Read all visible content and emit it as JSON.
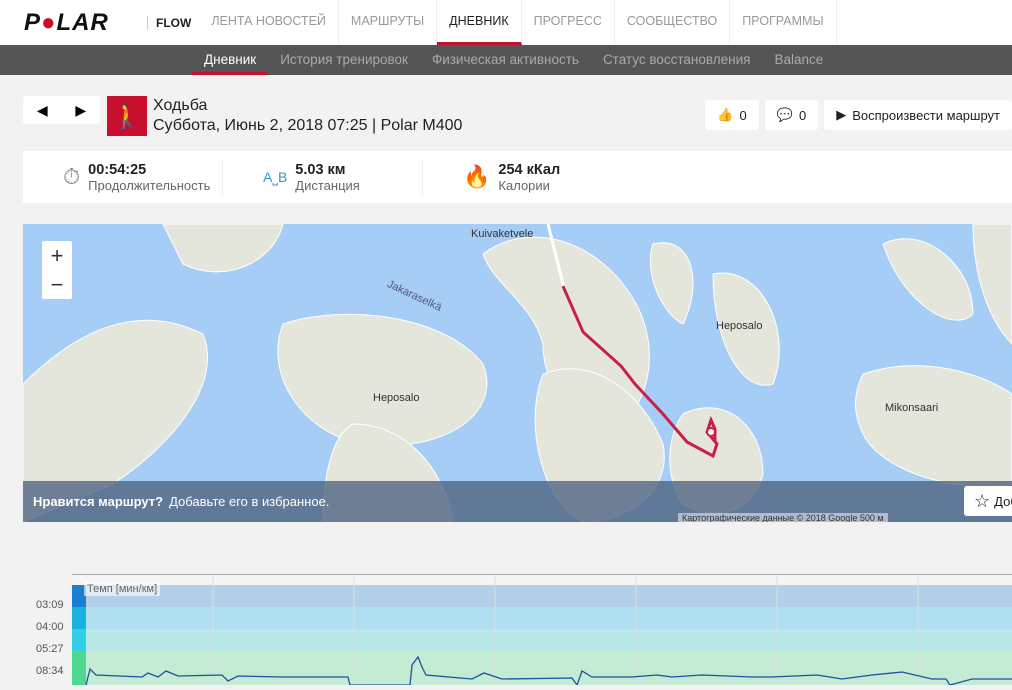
{
  "topnav": {
    "logo": "POLAR",
    "flow": "FLOW",
    "items": [
      "ЛЕНТА НОВОСТЕЙ",
      "МАРШРУТЫ",
      "ДНЕВНИК",
      "ПРОГРЕСС",
      "СООБЩЕСТВО",
      "ПРОГРАММЫ"
    ],
    "active": "ДНЕВНИК"
  },
  "subnav": {
    "items": [
      "Дневник",
      "История тренировок",
      "Физическая активность",
      "Статус восстановления",
      "Balance"
    ]
  },
  "session": {
    "sport": "Ходьба",
    "subtitle": "Суббота, Июнь 2, 2018 07:25 | Polar M400",
    "likes": "0",
    "comments": "0",
    "replay": "Воспроизвести маршрут"
  },
  "stats": [
    {
      "value": "00:54:25",
      "label": "Продолжительность",
      "icon": "stopwatch-icon"
    },
    {
      "value": "5.03 км",
      "label": "Дистанция",
      "icon": "distance-icon"
    },
    {
      "value": "254 кКал",
      "label": "Калории",
      "icon": "flame-icon"
    }
  ],
  "map": {
    "zoom_in": "+",
    "zoom_out": "−",
    "labels": [
      "Kuivaketvele",
      "Jakarasel­kä",
      "Heposalo",
      "Heposalo",
      "Mikonsaari"
    ],
    "like_bold": "Нравится маршрут?",
    "like_text": "Добавьте его в избранное.",
    "fav": "Добавить",
    "attribution": "Картографические данные © 2018 Google   500 м",
    "google": "Google",
    "route_color": "#c8204a"
  },
  "chart": {
    "title": "Темп [мин/км]",
    "yticks": [
      "03:09",
      "04:00",
      "05:27",
      "08:34"
    ]
  }
}
